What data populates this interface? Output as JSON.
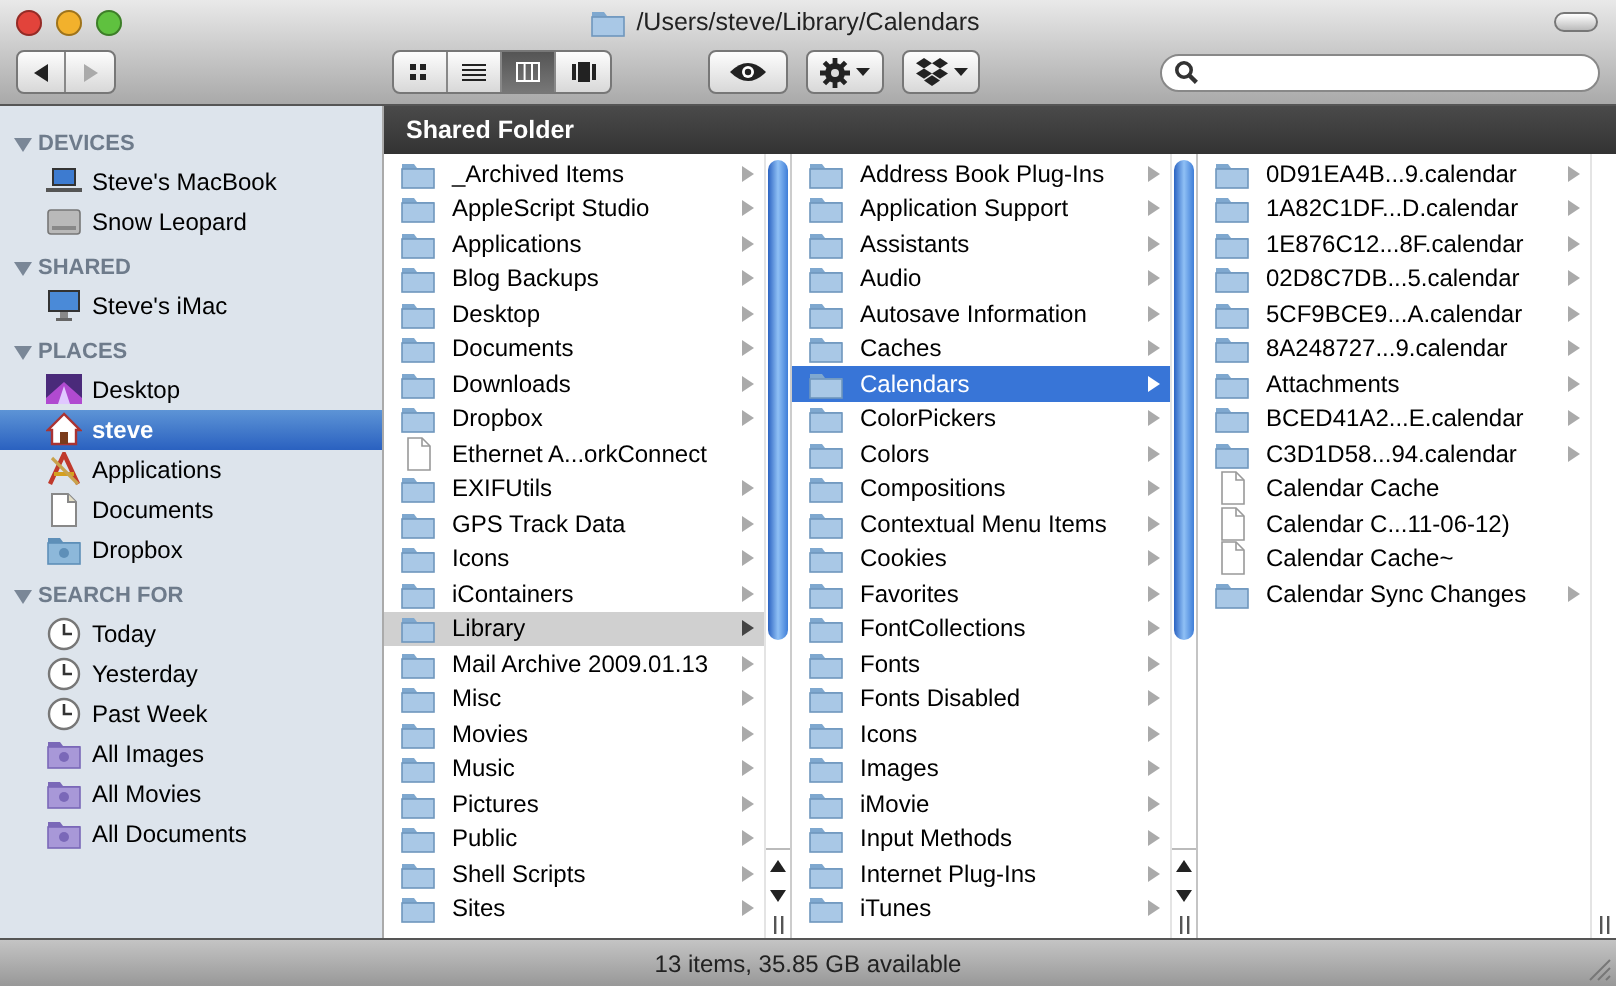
{
  "window": {
    "title": "/Users/steve/Library/Calendars"
  },
  "toolbar": {
    "view_modes": [
      {
        "kind": "icons",
        "selected": false
      },
      {
        "kind": "list",
        "selected": false
      },
      {
        "kind": "columns",
        "selected": true
      },
      {
        "kind": "coverflow",
        "selected": false
      }
    ]
  },
  "sidebar": {
    "sections": [
      {
        "title": "DEVICES",
        "expanded": true,
        "items": [
          {
            "label": "Steve's MacBook",
            "kind": "laptop",
            "selected": false
          },
          {
            "label": "Snow Leopard",
            "kind": "disk",
            "selected": false
          }
        ]
      },
      {
        "title": "SHARED",
        "expanded": true,
        "items": [
          {
            "label": "Steve's iMac",
            "kind": "monitor",
            "selected": false
          }
        ]
      },
      {
        "title": "PLACES",
        "expanded": true,
        "items": [
          {
            "label": "Desktop",
            "kind": "desktop",
            "selected": false
          },
          {
            "label": "steve",
            "kind": "home",
            "selected": true
          },
          {
            "label": "Applications",
            "kind": "apps",
            "selected": false
          },
          {
            "label": "Documents",
            "kind": "document",
            "selected": false
          },
          {
            "label": "Dropbox",
            "kind": "folder",
            "selected": false
          }
        ]
      },
      {
        "title": "SEARCH FOR",
        "expanded": true,
        "items": [
          {
            "label": "Today",
            "kind": "clock",
            "selected": false
          },
          {
            "label": "Yesterday",
            "kind": "clock",
            "selected": false
          },
          {
            "label": "Past Week",
            "kind": "clock",
            "selected": false
          },
          {
            "label": "All Images",
            "kind": "smart",
            "selected": false
          },
          {
            "label": "All Movies",
            "kind": "smart",
            "selected": false
          },
          {
            "label": "All Documents",
            "kind": "smart",
            "selected": false
          }
        ]
      }
    ]
  },
  "header": {
    "title": "Shared Folder"
  },
  "columns": [
    {
      "focused": false,
      "items": [
        {
          "label": "_Archived Items",
          "kind": "folder",
          "selected": false
        },
        {
          "label": "AppleScript Studio",
          "kind": "folder",
          "selected": false
        },
        {
          "label": "Applications",
          "kind": "folder",
          "selected": false
        },
        {
          "label": "Blog Backups",
          "kind": "folder",
          "selected": false
        },
        {
          "label": "Desktop",
          "kind": "folder",
          "selected": false
        },
        {
          "label": "Documents",
          "kind": "folder",
          "selected": false
        },
        {
          "label": "Downloads",
          "kind": "folder",
          "selected": false
        },
        {
          "label": "Dropbox",
          "kind": "folder",
          "selected": false
        },
        {
          "label": "Ethernet A...orkConnect",
          "kind": "file",
          "selected": false
        },
        {
          "label": "EXIFUtils",
          "kind": "folder",
          "selected": false
        },
        {
          "label": "GPS Track Data",
          "kind": "folder",
          "selected": false
        },
        {
          "label": "Icons",
          "kind": "folder",
          "selected": false
        },
        {
          "label": "iContainers",
          "kind": "folder",
          "selected": false
        },
        {
          "label": "Library",
          "kind": "folder",
          "selected": true
        },
        {
          "label": "Mail Archive 2009.01.13",
          "kind": "folder",
          "selected": false
        },
        {
          "label": "Misc",
          "kind": "folder",
          "selected": false
        },
        {
          "label": "Movies",
          "kind": "folder",
          "selected": false
        },
        {
          "label": "Music",
          "kind": "folder",
          "selected": false
        },
        {
          "label": "Pictures",
          "kind": "folder",
          "selected": false
        },
        {
          "label": "Public",
          "kind": "folder",
          "selected": false
        },
        {
          "label": "Shell Scripts",
          "kind": "folder",
          "selected": false
        },
        {
          "label": "Sites",
          "kind": "folder",
          "selected": false
        }
      ]
    },
    {
      "focused": true,
      "items": [
        {
          "label": "Address Book Plug-Ins",
          "kind": "folder",
          "selected": false
        },
        {
          "label": "Application Support",
          "kind": "folder",
          "selected": false
        },
        {
          "label": "Assistants",
          "kind": "folder",
          "selected": false
        },
        {
          "label": "Audio",
          "kind": "folder",
          "selected": false
        },
        {
          "label": "Autosave Information",
          "kind": "folder",
          "selected": false
        },
        {
          "label": "Caches",
          "kind": "folder",
          "selected": false
        },
        {
          "label": "Calendars",
          "kind": "folder",
          "selected": true
        },
        {
          "label": "ColorPickers",
          "kind": "folder",
          "selected": false
        },
        {
          "label": "Colors",
          "kind": "folder",
          "selected": false
        },
        {
          "label": "Compositions",
          "kind": "folder",
          "selected": false
        },
        {
          "label": "Contextual Menu Items",
          "kind": "folder",
          "selected": false
        },
        {
          "label": "Cookies",
          "kind": "folder",
          "selected": false
        },
        {
          "label": "Favorites",
          "kind": "folder",
          "selected": false
        },
        {
          "label": "FontCollections",
          "kind": "folder",
          "selected": false
        },
        {
          "label": "Fonts",
          "kind": "folder",
          "selected": false
        },
        {
          "label": "Fonts Disabled",
          "kind": "folder",
          "selected": false
        },
        {
          "label": "Icons",
          "kind": "folder",
          "selected": false
        },
        {
          "label": "Images",
          "kind": "folder",
          "selected": false
        },
        {
          "label": "iMovie",
          "kind": "folder",
          "selected": false
        },
        {
          "label": "Input Methods",
          "kind": "folder",
          "selected": false
        },
        {
          "label": "Internet Plug-Ins",
          "kind": "folder",
          "selected": false
        },
        {
          "label": "iTunes",
          "kind": "folder",
          "selected": false
        }
      ]
    },
    {
      "items": [
        {
          "label": "0D91EA4B...9.calendar",
          "kind": "folder",
          "selected": false
        },
        {
          "label": "1A82C1DF...D.calendar",
          "kind": "folder",
          "selected": false
        },
        {
          "label": "1E876C12...8F.calendar",
          "kind": "folder",
          "selected": false
        },
        {
          "label": "02D8C7DB...5.calendar",
          "kind": "folder",
          "selected": false
        },
        {
          "label": "5CF9BCE9...A.calendar",
          "kind": "folder",
          "selected": false
        },
        {
          "label": "8A248727...9.calendar",
          "kind": "folder",
          "selected": false
        },
        {
          "label": "Attachments",
          "kind": "folder",
          "selected": false
        },
        {
          "label": "BCED41A2...E.calendar",
          "kind": "folder",
          "selected": false
        },
        {
          "label": "C3D1D58...94.calendar",
          "kind": "folder",
          "selected": false
        },
        {
          "label": "Calendar Cache",
          "kind": "file",
          "selected": false
        },
        {
          "label": "Calendar C...11-06-12)",
          "kind": "file",
          "selected": false
        },
        {
          "label": "Calendar Cache~",
          "kind": "file",
          "selected": false
        },
        {
          "label": "Calendar Sync Changes",
          "kind": "folder",
          "selected": false
        }
      ]
    }
  ],
  "status_bar": {
    "text": "13 items, 35.85 GB available"
  }
}
